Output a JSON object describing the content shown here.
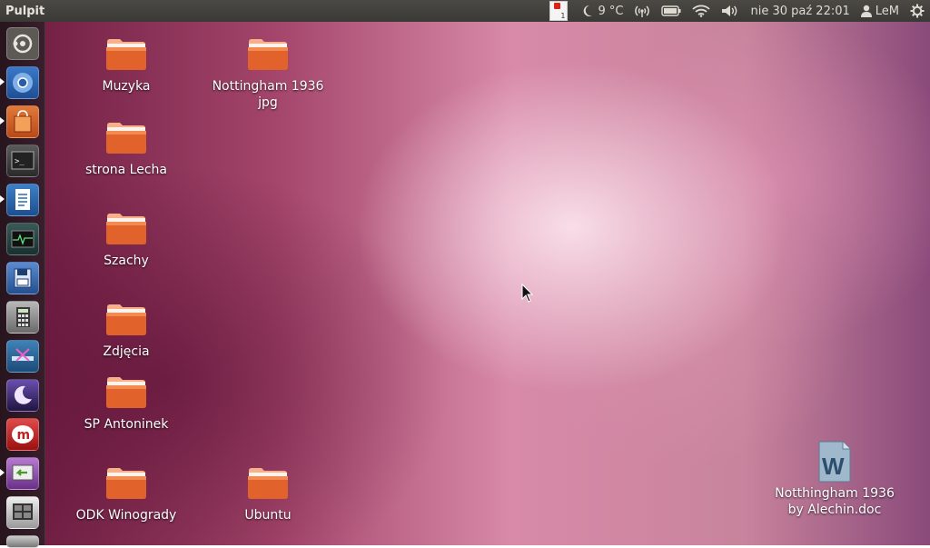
{
  "top_panel": {
    "title": "Pulpit",
    "calendar_badge_number": "1",
    "weather": "9 °C",
    "datetime": "nie 30 paź 22:01",
    "user": "LeM",
    "icons": [
      "calendar-notification-icon",
      "moon-weather-icon",
      "network-signal-icon",
      "battery-icon",
      "wifi-icon",
      "volume-icon",
      "user-icon",
      "session-gear-icon"
    ]
  },
  "launcher": {
    "items": [
      {
        "name": "dash-home",
        "color": "#5a5a5a"
      },
      {
        "name": "chromium",
        "color": "#2a5da8"
      },
      {
        "name": "software-center",
        "color": "#c85a20"
      },
      {
        "name": "terminal",
        "color": "#2b2b2b"
      },
      {
        "name": "libreoffice-writer",
        "color": "#2d6ab0"
      },
      {
        "name": "system-monitor",
        "color": "#1f3b3a"
      },
      {
        "name": "save-floppy-app",
        "color": "#2f5fa5"
      },
      {
        "name": "calculator",
        "color": "#8a8a8a"
      },
      {
        "name": "network-app",
        "color": "#2f6fa0"
      },
      {
        "name": "night-sky-app",
        "color": "#3b2f6a"
      },
      {
        "name": "mendeley",
        "color": "#c02020"
      },
      {
        "name": "remote-desktop",
        "color": "#8a4a9a"
      },
      {
        "name": "workspace-switcher",
        "color": "#4a4a4a"
      }
    ]
  },
  "desktop": {
    "icons": [
      {
        "label": "Muzyka",
        "type": "folder"
      },
      {
        "label": "Nottingham 1936\njpg",
        "type": "folder"
      },
      {
        "label": "strona Lecha",
        "type": "folder"
      },
      {
        "label": "Szachy",
        "type": "folder"
      },
      {
        "label": "Zdjęcia",
        "type": "folder"
      },
      {
        "label": "SP Antoninek",
        "type": "folder"
      },
      {
        "label": "ODK Winogrady",
        "type": "folder"
      },
      {
        "label": "Ubuntu",
        "type": "folder"
      },
      {
        "label": "Notthingham 1936\nby Alechin.doc",
        "type": "word-document"
      }
    ]
  },
  "colors": {
    "folder_orange": "#e2622b",
    "panel_bg": "#3c3b37",
    "accent": "#dd4814"
  }
}
